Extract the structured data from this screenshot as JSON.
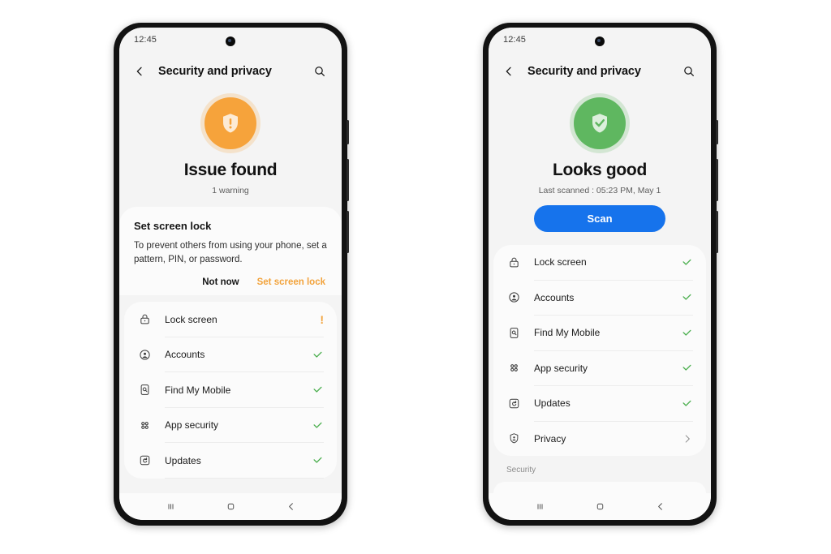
{
  "accents": {
    "warning": "#f2a33c",
    "success": "#5fb860",
    "primary_button": "#1673ec",
    "screen_bg": "#f4f4f4",
    "card_bg": "#fbfbfb"
  },
  "phones": [
    {
      "id": "phone-warning-state",
      "status_bar": {
        "time": "12:45"
      },
      "app_bar": {
        "back_icon": "chevron-left-icon",
        "title": "Security and privacy",
        "search_icon": "search-icon"
      },
      "hero": {
        "icon": "shield-exclamation-icon",
        "state": "warning",
        "title": "Issue found",
        "subtitle": "1 warning"
      },
      "notice_card": {
        "title": "Set screen lock",
        "body": "To prevent others from using your phone, set a pattern, PIN, or password.",
        "secondary_action": "Not now",
        "primary_action": "Set screen lock"
      },
      "list": [
        {
          "icon": "lock-icon",
          "label": "Lock screen",
          "status": "warning"
        },
        {
          "icon": "account-circle-icon",
          "label": "Accounts",
          "status": "ok"
        },
        {
          "icon": "find-my-mobile-icon",
          "label": "Find My Mobile",
          "status": "ok"
        },
        {
          "icon": "app-security-icon",
          "label": "App security",
          "status": "ok"
        },
        {
          "icon": "updates-icon",
          "label": "Updates",
          "status": "ok"
        }
      ],
      "nav_bar": {
        "recents_icon": "recents-icon",
        "home_icon": "home-icon",
        "back_icon": "back-icon"
      }
    },
    {
      "id": "phone-ok-state",
      "status_bar": {
        "time": "12:45"
      },
      "app_bar": {
        "back_icon": "chevron-left-icon",
        "title": "Security and privacy",
        "search_icon": "search-icon"
      },
      "hero": {
        "icon": "shield-check-icon",
        "state": "ok",
        "title": "Looks good",
        "subtitle": "Last scanned : 05:23 PM, May 1",
        "scan_button": "Scan"
      },
      "list": [
        {
          "icon": "lock-icon",
          "label": "Lock screen",
          "status": "ok"
        },
        {
          "icon": "account-circle-icon",
          "label": "Accounts",
          "status": "ok"
        },
        {
          "icon": "find-my-mobile-icon",
          "label": "Find My Mobile",
          "status": "ok"
        },
        {
          "icon": "app-security-icon",
          "label": "App security",
          "status": "ok"
        },
        {
          "icon": "updates-icon",
          "label": "Updates",
          "status": "ok"
        },
        {
          "icon": "privacy-shield-person-icon",
          "label": "Privacy",
          "status": "chevron"
        }
      ],
      "section_label": "Security",
      "nav_bar": {
        "recents_icon": "recents-icon",
        "home_icon": "home-icon",
        "back_icon": "back-icon"
      }
    }
  ]
}
